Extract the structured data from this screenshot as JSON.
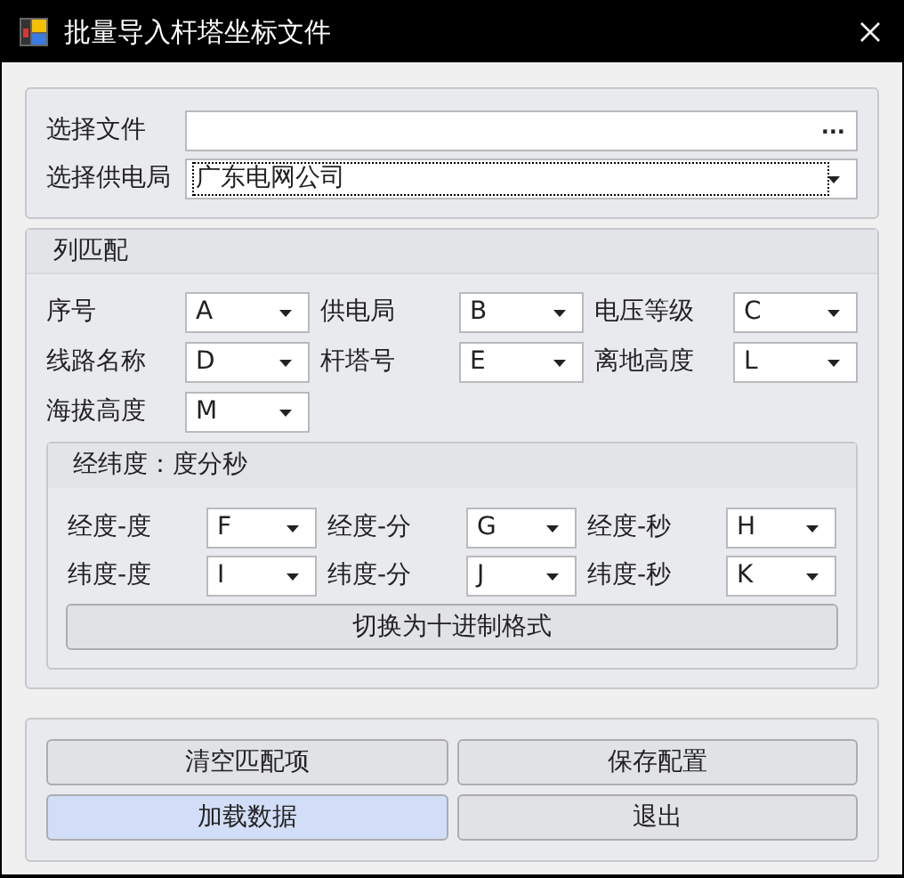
{
  "window": {
    "title": "批量导入杆塔坐标文件"
  },
  "source": {
    "file_label": "选择文件",
    "browse": "···",
    "bureau_label": "选择供电局",
    "bureau_value": "广东电网公司",
    "bureau_focused": true
  },
  "columns": {
    "title": "列匹配",
    "fields": [
      {
        "label": "序号",
        "value": "A"
      },
      {
        "label": "供电局",
        "value": "B"
      },
      {
        "label": "电压等级",
        "value": "C"
      },
      {
        "label": "线路名称",
        "value": "D"
      },
      {
        "label": "杆塔号",
        "value": "E"
      },
      {
        "label": "离地高度",
        "value": "L"
      },
      {
        "label": "海拔高度",
        "value": "M"
      }
    ]
  },
  "coordinates": {
    "title": "经纬度：度分秒",
    "fields": [
      {
        "label": "经度-度",
        "value": "F"
      },
      {
        "label": "经度-分",
        "value": "G"
      },
      {
        "label": "经度-秒",
        "value": "H"
      },
      {
        "label": "纬度-度",
        "value": "I"
      },
      {
        "label": "纬度-分",
        "value": "J"
      },
      {
        "label": "纬度-秒",
        "value": "K"
      }
    ],
    "switch_button": "切换为十进制格式"
  },
  "buttons": [
    {
      "label": "清空匹配项",
      "highlighted": false
    },
    {
      "label": "保存配置",
      "highlighted": false
    },
    {
      "label": "加载数据",
      "highlighted": true
    },
    {
      "label": "退出",
      "highlighted": false
    }
  ]
}
